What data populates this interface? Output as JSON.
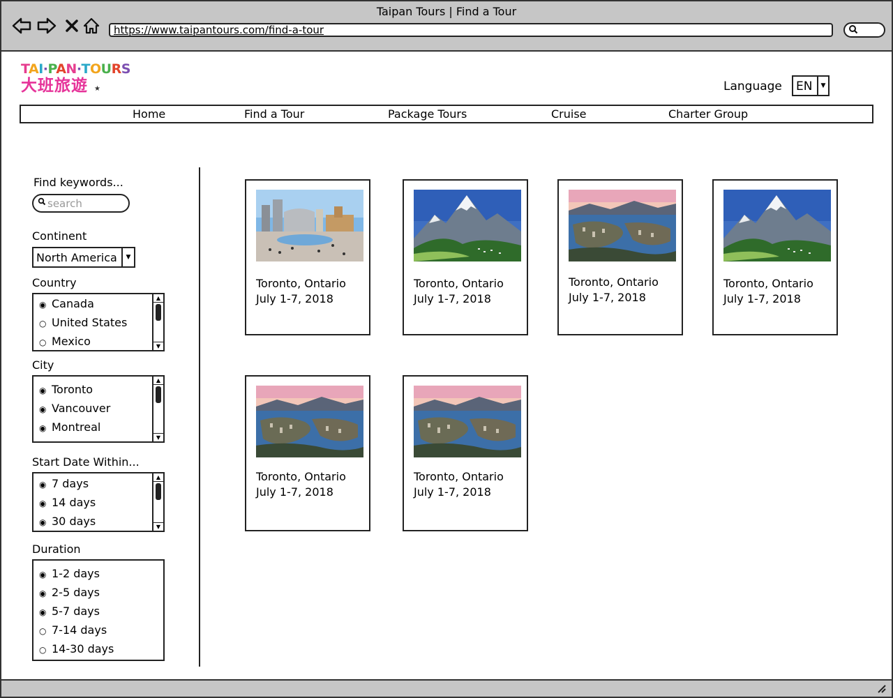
{
  "browser": {
    "title": "Taipan Tours | Find a Tour",
    "url": "https://www.taipantours.com/find-a-tour"
  },
  "logo": {
    "en": "TAI·PAN·TOURS",
    "zh": "大班旅遊"
  },
  "language": {
    "label": "Language",
    "value": "EN"
  },
  "nav": [
    "Home",
    "Find a Tour",
    "Package Tours",
    "Cruise",
    "Charter Group"
  ],
  "filters": {
    "keywords_label": "Find keywords...",
    "search_placeholder": "search",
    "continent_label": "Continent",
    "continent_value": "North America",
    "country_label": "Country",
    "countries": [
      {
        "label": "Canada",
        "selected": true
      },
      {
        "label": "United States",
        "selected": false
      },
      {
        "label": "Mexico",
        "selected": false
      }
    ],
    "city_label": "City",
    "cities": [
      {
        "label": "Toronto",
        "selected": true
      },
      {
        "label": "Vancouver",
        "selected": true
      },
      {
        "label": "Montreal",
        "selected": true
      }
    ],
    "start_label": "Start Date Within...",
    "start_options": [
      {
        "label": "7 days",
        "selected": true
      },
      {
        "label": "14 days",
        "selected": true
      },
      {
        "label": "30 days",
        "selected": true
      }
    ],
    "duration_label": "Duration",
    "durations": [
      {
        "label": "1-2 days",
        "selected": true
      },
      {
        "label": "2-5 days",
        "selected": true
      },
      {
        "label": "5-7 days",
        "selected": true
      },
      {
        "label": "7-14 days",
        "selected": false
      },
      {
        "label": "14-30 days",
        "selected": false
      }
    ]
  },
  "tours": [
    {
      "place": "Toronto, Ontario",
      "date": "July 1-7, 2018",
      "photo": "city-hall"
    },
    {
      "place": "Toronto, Ontario",
      "date": "July 1-7, 2018",
      "photo": "mountain"
    },
    {
      "place": "Toronto, Ontario",
      "date": "July 1-7, 2018",
      "photo": "harbour"
    },
    {
      "place": "Toronto, Ontario",
      "date": "July 1-7, 2018",
      "photo": "mountain"
    },
    {
      "place": "Toronto, Ontario",
      "date": "July 1-7, 2018",
      "photo": "harbour"
    },
    {
      "place": "Toronto, Ontario",
      "date": "July 1-7, 2018",
      "photo": "harbour"
    }
  ],
  "icons": {
    "back": "back-arrow-icon",
    "forward": "forward-arrow-icon",
    "close": "close-icon",
    "home": "home-icon",
    "search": "search-icon",
    "dropdown": "chevron-down-icon",
    "resize": "resize-grip-icon"
  }
}
